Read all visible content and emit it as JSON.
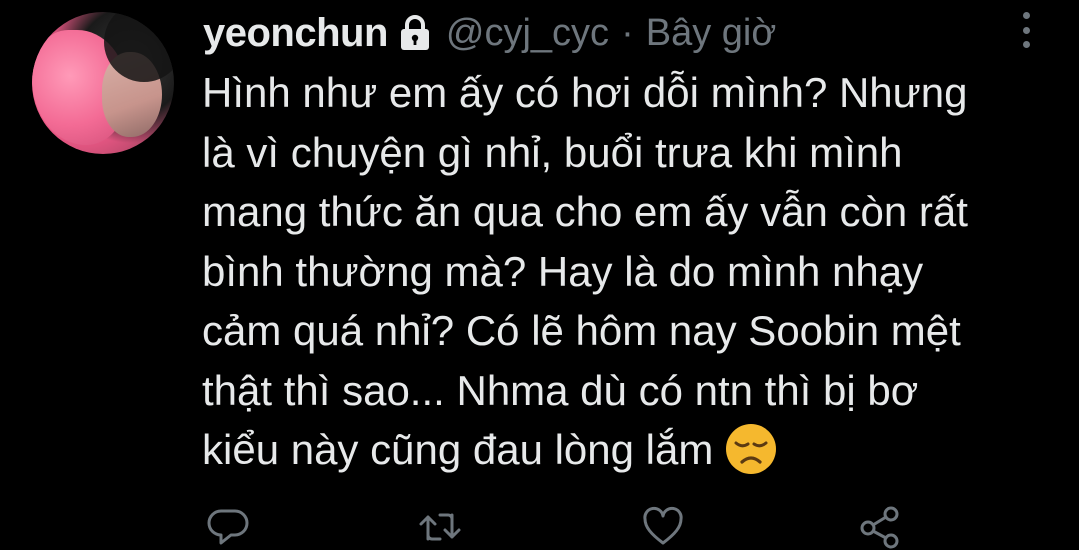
{
  "tweet": {
    "author_name": "yeonchun",
    "handle": "@cyj_cyc",
    "separator": "·",
    "time": "Bây giờ",
    "protected_icon": "lock-icon",
    "body_lines": [
      "Hình như em ấy có hơi dỗi mình? Nhưng",
      "là vì chuyện gì nhỉ, buổi trưa khi mình",
      "mang thức ăn qua cho em ấy vẫn còn rất",
      "bình thường mà? Hay là do mình nhạy",
      "cảm quá nhỉ? Có lẽ hôm nay Soobin mệt",
      "thật thì sao... Nhma dù có ntn thì bị bơ",
      "kiểu này cũng đau lòng lắm"
    ],
    "emoji": "disappointed-face-emoji"
  },
  "actions": [
    "reply-icon",
    "retweet-icon",
    "like-icon",
    "share-icon"
  ],
  "menu_icon": "more-vertical-icon",
  "colors": {
    "background": "#000000",
    "text": "#e7e9ea",
    "secondary": "#6e767d",
    "emoji": "#f5b82e"
  }
}
